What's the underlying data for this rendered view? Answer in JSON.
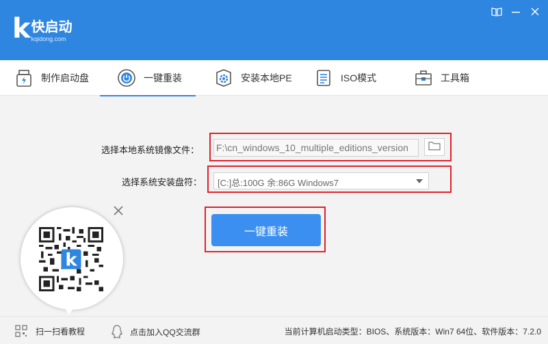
{
  "app": {
    "logo_letter": "k",
    "name": "快启动",
    "url": "kqidong.com"
  },
  "window_controls": [
    "book-icon",
    "minimize-icon",
    "close-icon"
  ],
  "tabs": [
    {
      "label": "制作启动盘",
      "icon": "usb-drive-icon",
      "active": false
    },
    {
      "label": "一键重装",
      "icon": "power-icon",
      "active": true
    },
    {
      "label": "安装本地PE",
      "icon": "gear-box-icon",
      "active": false
    },
    {
      "label": "ISO模式",
      "icon": "document-icon",
      "active": false
    },
    {
      "label": "工具箱",
      "icon": "toolbox-icon",
      "active": false
    }
  ],
  "form": {
    "image_label": "选择本地系统镜像文件：",
    "image_path": "F:\\cn_windows_10_multiple_editions_version",
    "disk_label": "选择系统安装盘符：",
    "disk_value": "[C:]总:100G 余:86G Windows7",
    "reinstall_button": "一键重装"
  },
  "footer": {
    "scan_label": "扫一扫看教程",
    "qq_label": "点击加入QQ交流群",
    "status": "当前计算机启动类型：BIOS、系统版本：Win7 64位、软件版本：7.2.0"
  },
  "colors": {
    "brand": "#2e86e0",
    "button": "#3a8ff0",
    "highlight": "#e0202a"
  }
}
